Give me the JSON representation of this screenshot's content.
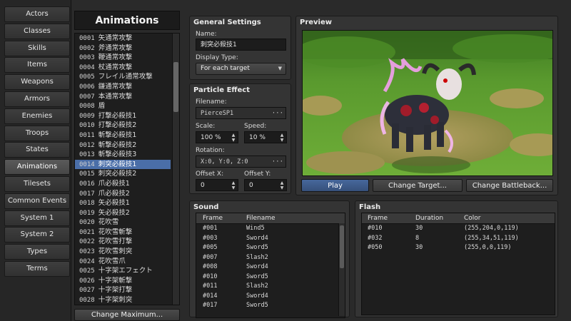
{
  "sidebar": {
    "items": [
      {
        "label": "Actors"
      },
      {
        "label": "Classes"
      },
      {
        "label": "Skills"
      },
      {
        "label": "Items"
      },
      {
        "label": "Weapons"
      },
      {
        "label": "Armors"
      },
      {
        "label": "Enemies"
      },
      {
        "label": "Troops"
      },
      {
        "label": "States"
      },
      {
        "label": "Animations"
      },
      {
        "label": "Tilesets"
      },
      {
        "label": "Common Events"
      },
      {
        "label": "System 1"
      },
      {
        "label": "System 2"
      },
      {
        "label": "Types"
      },
      {
        "label": "Terms"
      }
    ],
    "active_index": 9
  },
  "list": {
    "title": "Animations",
    "items": [
      {
        "num": "0001",
        "name": "矢通常攻撃"
      },
      {
        "num": "0002",
        "name": "斧通常攻撃"
      },
      {
        "num": "0003",
        "name": "鞭通常攻撃"
      },
      {
        "num": "0004",
        "name": "杖通常攻撃"
      },
      {
        "num": "0005",
        "name": "フレイル通常攻撃"
      },
      {
        "num": "0006",
        "name": "鎌通常攻撃"
      },
      {
        "num": "0007",
        "name": "本通常攻撃"
      },
      {
        "num": "0008",
        "name": "盾"
      },
      {
        "num": "0009",
        "name": "打撃必殺技1"
      },
      {
        "num": "0010",
        "name": "打撃必殺技2"
      },
      {
        "num": "0011",
        "name": "斬撃必殺技1"
      },
      {
        "num": "0012",
        "name": "斬撃必殺技2"
      },
      {
        "num": "0013",
        "name": "斬撃必殺技3"
      },
      {
        "num": "0014",
        "name": "刺突必殺技1"
      },
      {
        "num": "0015",
        "name": "刺突必殺技2"
      },
      {
        "num": "0016",
        "name": "爪必殺技1"
      },
      {
        "num": "0017",
        "name": "爪必殺技2"
      },
      {
        "num": "0018",
        "name": "矢必殺技1"
      },
      {
        "num": "0019",
        "name": "矢必殺技2"
      },
      {
        "num": "0020",
        "name": "花吹雪"
      },
      {
        "num": "0021",
        "name": "花吹雪斬撃"
      },
      {
        "num": "0022",
        "name": "花吹雪打撃"
      },
      {
        "num": "0023",
        "name": "花吹雪刺突"
      },
      {
        "num": "0024",
        "name": "花吹雪爪"
      },
      {
        "num": "0025",
        "name": "十字架エフェクト"
      },
      {
        "num": "0026",
        "name": "十字架斬撃"
      },
      {
        "num": "0027",
        "name": "十字架打撃"
      },
      {
        "num": "0028",
        "name": "十字架刺突"
      }
    ],
    "selected_index": 13,
    "change_max_label": "Change Maximum..."
  },
  "general": {
    "title": "General Settings",
    "name_label": "Name:",
    "name_value": "刺突必殺技1",
    "display_type_label": "Display Type:",
    "display_type_value": "For each target"
  },
  "particle": {
    "title": "Particle Effect",
    "filename_label": "Filename:",
    "filename_value": "PierceSP1",
    "scale_label": "Scale:",
    "scale_value": "100 %",
    "speed_label": "Speed:",
    "speed_value": "10 %",
    "rotation_label": "Rotation:",
    "rotation_value": "X:0, Y:0, Z:0",
    "offset_x_label": "Offset X:",
    "offset_x_value": "0",
    "offset_y_label": "Offset Y:",
    "offset_y_value": "0"
  },
  "preview": {
    "title": "Preview",
    "play_label": "Play",
    "change_target_label": "Change Target...",
    "change_battleback_label": "Change Battleback..."
  },
  "sound": {
    "title": "Sound",
    "columns": [
      "Frame",
      "Filename"
    ],
    "rows": [
      {
        "frame": "#001",
        "file": "Wind5"
      },
      {
        "frame": "#003",
        "file": "Sword4"
      },
      {
        "frame": "#005",
        "file": "Sword5"
      },
      {
        "frame": "#007",
        "file": "Slash2"
      },
      {
        "frame": "#008",
        "file": "Sword4"
      },
      {
        "frame": "#010",
        "file": "Sword5"
      },
      {
        "frame": "#011",
        "file": "Slash2"
      },
      {
        "frame": "#014",
        "file": "Sword4"
      },
      {
        "frame": "#017",
        "file": "Sword5"
      }
    ]
  },
  "flash": {
    "title": "Flash",
    "columns": [
      "Frame",
      "Duration",
      "Color"
    ],
    "rows": [
      {
        "frame": "#010",
        "duration": "30",
        "color": "(255,204,0,119)"
      },
      {
        "frame": "#032",
        "duration": "8",
        "color": "(255,34,51,119)"
      },
      {
        "frame": "#050",
        "duration": "30",
        "color": "(255,0,0,119)"
      }
    ]
  },
  "icons": {
    "dropdown": "chevron-down-icon",
    "browse": "ellipsis-icon",
    "spinner": "spinner-arrows-icon"
  },
  "colors": {
    "selection": "#4a6ea8",
    "panel": "#343434",
    "background": "#2a2a2a"
  }
}
